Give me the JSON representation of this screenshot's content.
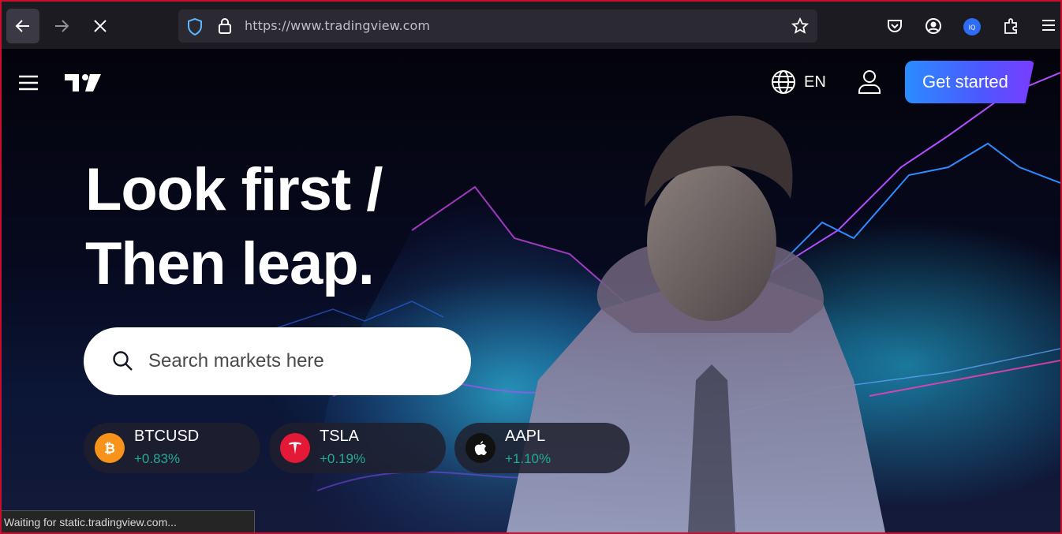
{
  "browser": {
    "url": "https://www.tradingview.com",
    "status_text": "Waiting for static.tradingview.com...",
    "icons": [
      "back-icon",
      "forward-icon",
      "stop-icon",
      "shield-icon",
      "lock-icon",
      "bookmark-star-icon",
      "pocket-icon",
      "account-icon",
      "extension-iq-icon",
      "extensions-icon",
      "menu-icon"
    ]
  },
  "header": {
    "language": "EN",
    "cta_label": "Get started"
  },
  "hero": {
    "headline_line1": "Look first /",
    "headline_line2": "Then leap."
  },
  "search": {
    "placeholder": "Search markets here"
  },
  "tickers": [
    {
      "symbol": "BTCUSD",
      "change": "+0.83%",
      "logo_color": "#f7931a"
    },
    {
      "symbol": "TSLA",
      "change": "+0.19%",
      "logo_color": "#e31937"
    },
    {
      "symbol": "AAPL",
      "change": "+1.10%",
      "logo_color": "#111111"
    }
  ],
  "colors": {
    "positive": "#22ab94",
    "cta_start": "#2a8cff",
    "cta_end": "#7a3cff",
    "toolbar": "#1c1b22"
  }
}
